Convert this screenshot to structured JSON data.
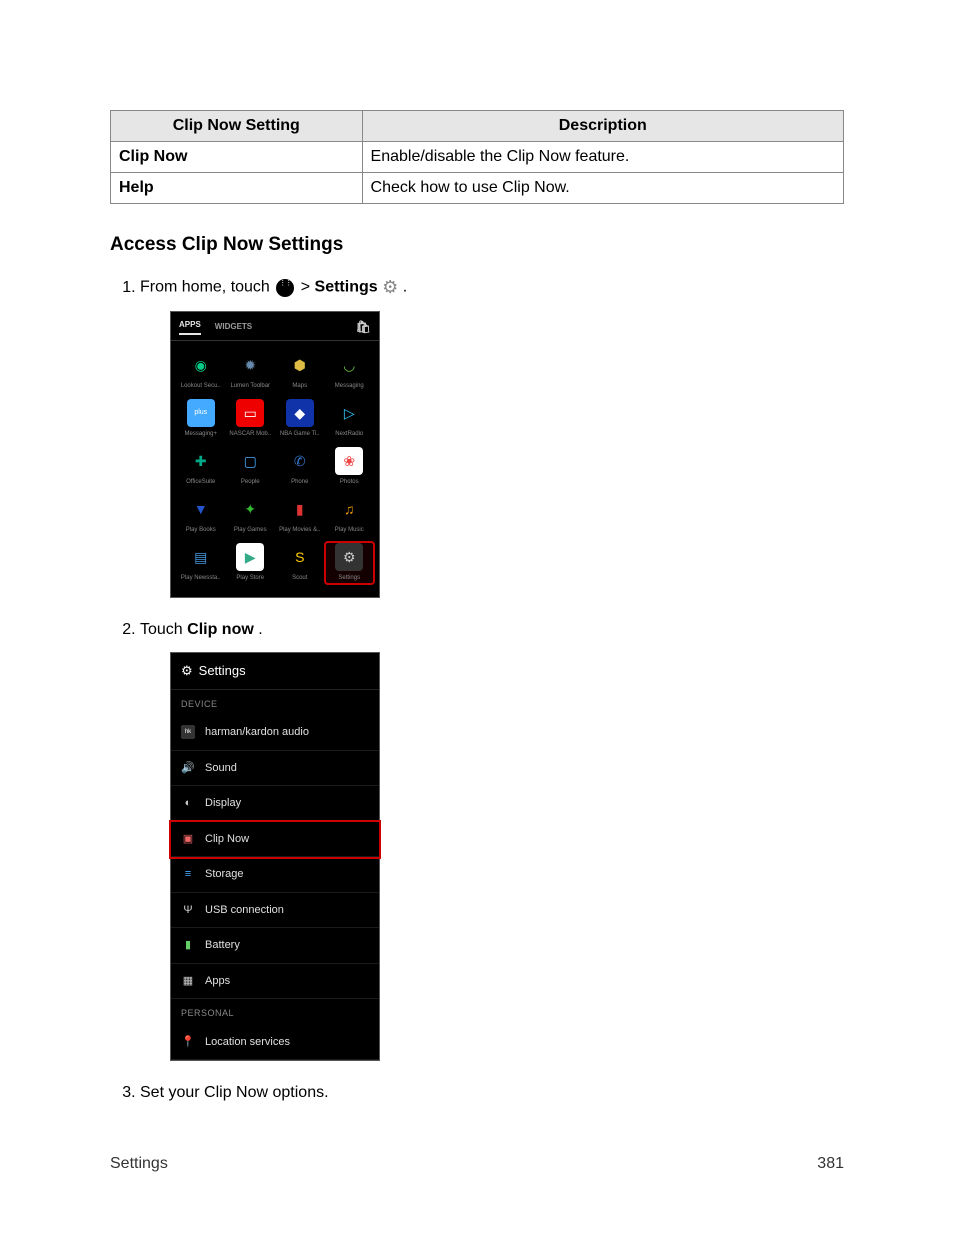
{
  "table": {
    "headers": [
      "Clip Now Setting",
      "Description"
    ],
    "rows": [
      {
        "setting": "Clip Now",
        "description": "Enable/disable the Clip Now feature."
      },
      {
        "setting": "Help",
        "description": "Check how to use Clip Now."
      }
    ]
  },
  "subheading": "Access Clip Now Settings",
  "steps": {
    "s1_pre": "From home, touch ",
    "s1_gt": " > ",
    "s1_settings_word": "Settings",
    "s1_period": ".",
    "s2_pre": "Touch ",
    "s2_bold": "Clip now",
    "s2_period": ".",
    "s3": "Set your Clip Now options."
  },
  "shot1": {
    "tab_apps": "APPS",
    "tab_widgets": "WIDGETS",
    "apps": [
      {
        "label": "Lookout Secu..",
        "bg": "#000",
        "glyph": "◉",
        "color": "#0c8"
      },
      {
        "label": "Lumen Toolbar",
        "bg": "#000",
        "glyph": "✹",
        "color": "#68a"
      },
      {
        "label": "Maps",
        "bg": "#000",
        "glyph": "⬢",
        "color": "#db4"
      },
      {
        "label": "Messaging",
        "bg": "#000",
        "glyph": "◡",
        "color": "#6b4"
      },
      {
        "label": "Messaging+",
        "bg": "#4af",
        "glyph": "plus",
        "color": "#fff"
      },
      {
        "label": "NASCAR Mob..",
        "bg": "#e00",
        "glyph": "▭",
        "color": "#fff"
      },
      {
        "label": "NBA Game Ti..",
        "bg": "#13a",
        "glyph": "◆",
        "color": "#fff"
      },
      {
        "label": "NextRadio",
        "bg": "#000",
        "glyph": "▷",
        "color": "#3cf"
      },
      {
        "label": "OfficeSuite",
        "bg": "#000",
        "glyph": "✚",
        "color": "#0a8"
      },
      {
        "label": "People",
        "bg": "#000",
        "glyph": "▢",
        "color": "#4af"
      },
      {
        "label": "Phone",
        "bg": "#000",
        "glyph": "✆",
        "color": "#37c"
      },
      {
        "label": "Photos",
        "bg": "#fff",
        "glyph": "❀",
        "color": "#e44"
      },
      {
        "label": "Play Books",
        "bg": "#000",
        "glyph": "▼",
        "color": "#25c"
      },
      {
        "label": "Play Games",
        "bg": "#000",
        "glyph": "✦",
        "color": "#3b3"
      },
      {
        "label": "Play Movies &..",
        "bg": "#000",
        "glyph": "▮",
        "color": "#d33"
      },
      {
        "label": "Play Music",
        "bg": "#000",
        "glyph": "♫",
        "color": "#e90"
      },
      {
        "label": "Play Newssta..",
        "bg": "#000",
        "glyph": "▤",
        "color": "#49d"
      },
      {
        "label": "Play Store",
        "bg": "#fff",
        "glyph": "▶",
        "color": "#3a8"
      },
      {
        "label": "Scout",
        "bg": "#000",
        "glyph": "S",
        "color": "#fc0"
      },
      {
        "label": "Settings",
        "bg": "#333",
        "glyph": "⚙",
        "color": "#ccc",
        "highlight": true
      }
    ]
  },
  "shot2": {
    "title": "Settings",
    "section_device": "DEVICE",
    "section_personal": "PERSONAL",
    "items": [
      {
        "icon": "hk",
        "label": "harman/kardon audio",
        "iconColor": "#fff",
        "iconBg": "#333"
      },
      {
        "icon": "🔊",
        "label": "Sound",
        "iconColor": "#ccc"
      },
      {
        "icon": "◐",
        "label": "Display",
        "iconColor": "#ccc"
      },
      {
        "icon": "▣",
        "label": "Clip Now",
        "iconColor": "#e66",
        "highlight": true
      },
      {
        "icon": "≡",
        "label": "Storage",
        "iconColor": "#4af"
      },
      {
        "icon": "Ψ",
        "label": "USB connection",
        "iconColor": "#ccc"
      },
      {
        "icon": "▮",
        "label": "Battery",
        "iconColor": "#6c6"
      },
      {
        "icon": "▦",
        "label": "Apps",
        "iconColor": "#ccc"
      }
    ],
    "personal_items": [
      {
        "icon": "📍",
        "label": "Location services",
        "iconColor": "#ccc"
      }
    ]
  },
  "footer": {
    "left": "Settings",
    "right": "381"
  }
}
